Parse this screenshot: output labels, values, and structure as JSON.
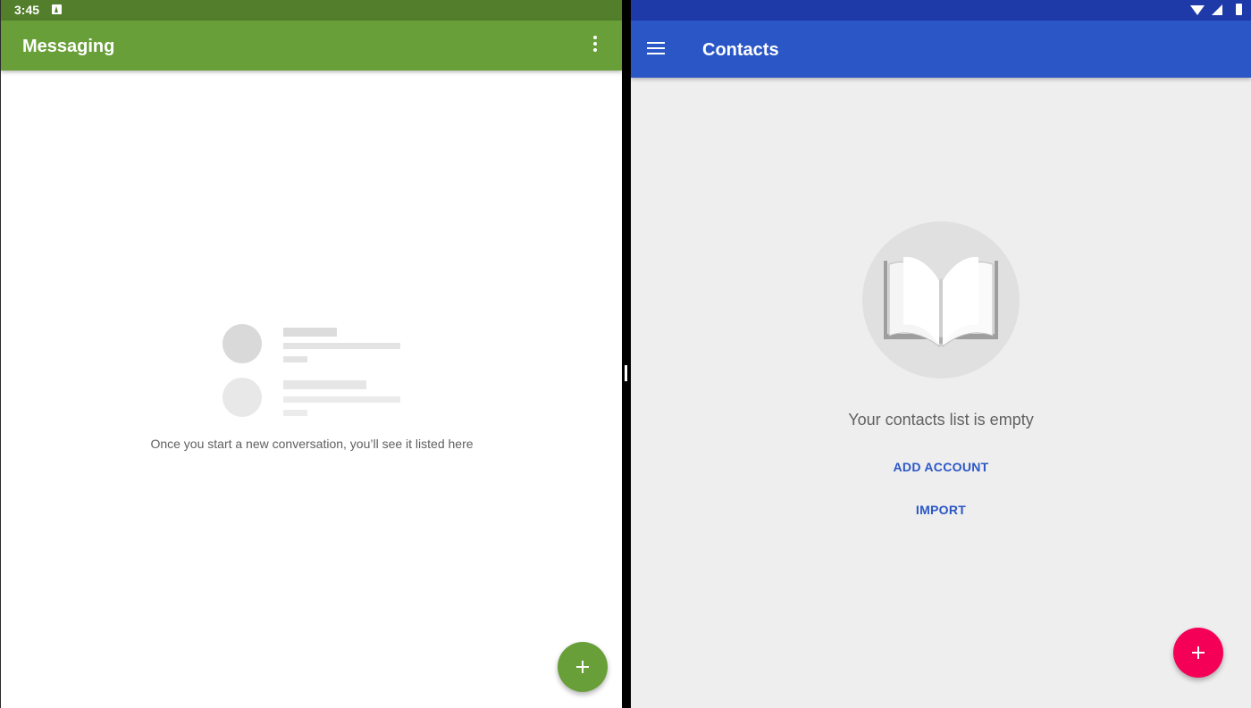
{
  "status_bar": {
    "time": "3:45"
  },
  "messaging": {
    "title": "Messaging",
    "empty_text": "Once you start a new conversation, you’ll see it listed here",
    "accent": "#689f38",
    "status_color": "#537f2c"
  },
  "contacts": {
    "title": "Contacts",
    "empty_text": "Your contacts list is empty",
    "add_account_label": "ADD ACCOUNT",
    "import_label": "IMPORT",
    "accent": "#2a56c6",
    "status_color": "#1e3aa9",
    "fab_color": "#f50057"
  },
  "icons": {
    "messaging_more": "more-vert-icon",
    "messaging_fab": "plus-icon",
    "contacts_menu": "hamburger-menu-icon",
    "contacts_fab": "plus-icon",
    "contacts_illustration": "open-book-icon"
  }
}
